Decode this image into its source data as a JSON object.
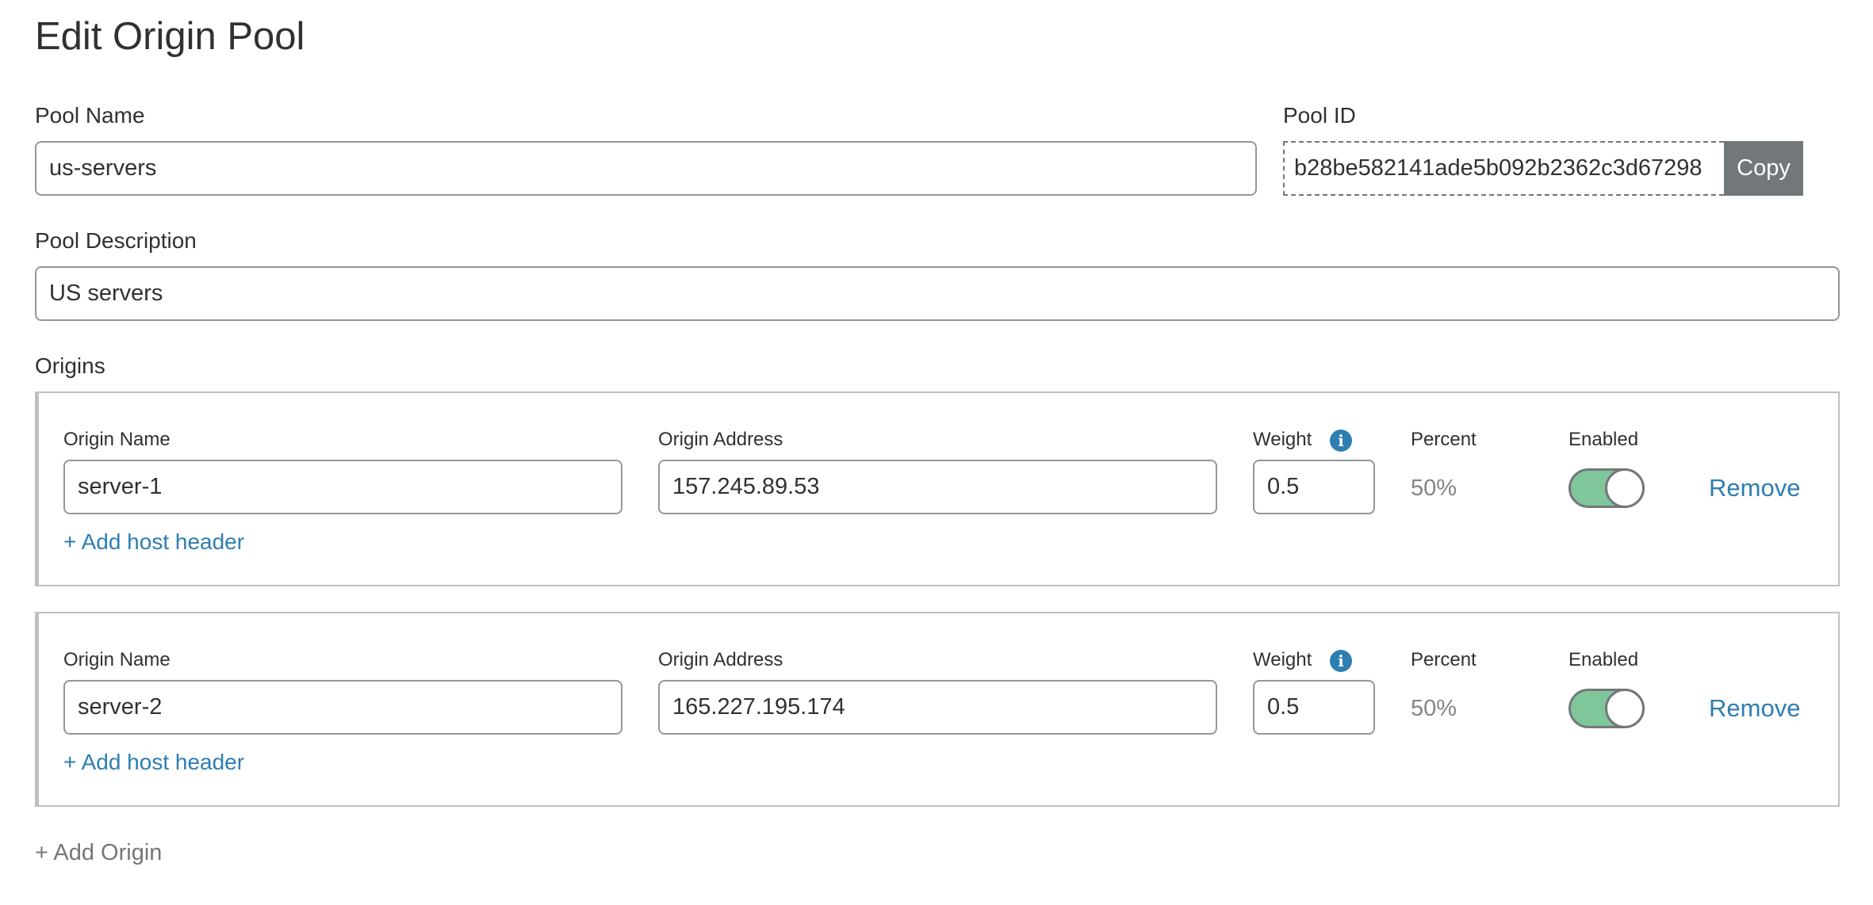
{
  "page": {
    "title": "Edit Origin Pool"
  },
  "pool_name": {
    "label": "Pool Name",
    "value": "us-servers"
  },
  "pool_id": {
    "label": "Pool ID",
    "value": "b28be582141ade5b092b2362c3d67298",
    "copy_label": "Copy"
  },
  "pool_description": {
    "label": "Pool Description",
    "value": "US servers"
  },
  "origins": {
    "label": "Origins",
    "items": [
      {
        "name_label": "Origin Name",
        "name": "server-1",
        "address_label": "Origin Address",
        "address": "157.245.89.53",
        "weight_label": "Weight",
        "weight": "0.5",
        "percent_label": "Percent",
        "percent": "50%",
        "enabled_label": "Enabled",
        "enabled": true,
        "remove_label": "Remove",
        "add_host_header_label": "+ Add host header"
      },
      {
        "name_label": "Origin Name",
        "name": "server-2",
        "address_label": "Origin Address",
        "address": "165.227.195.174",
        "weight_label": "Weight",
        "weight": "0.5",
        "percent_label": "Percent",
        "percent": "50%",
        "enabled_label": "Enabled",
        "enabled": true,
        "remove_label": "Remove",
        "add_host_header_label": "+ Add host header"
      }
    ],
    "add_origin_label": "+ Add Origin"
  },
  "icons": {
    "weight_info": "info-icon",
    "info_glyph": "i"
  },
  "colors": {
    "accent": "#2d7eb1",
    "toggle_on": "#7fc69b",
    "button_gray": "#72777a",
    "border": "#92979b"
  }
}
